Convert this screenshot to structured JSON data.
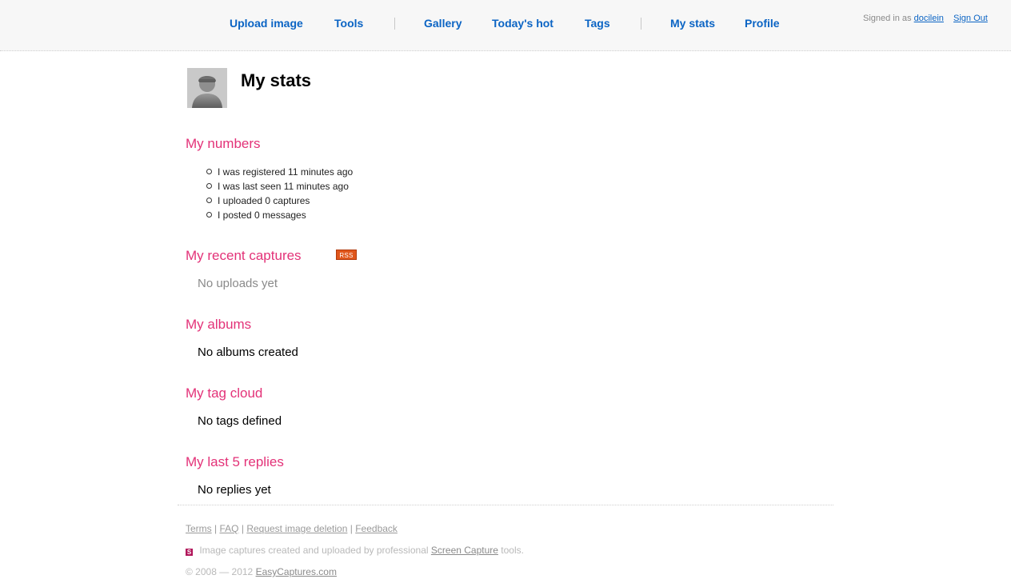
{
  "nav": {
    "upload": "Upload image",
    "tools": "Tools",
    "gallery": "Gallery",
    "todays_hot": "Today's hot",
    "tags": "Tags",
    "my_stats": "My stats",
    "profile": "Profile"
  },
  "session": {
    "signed_in_as": "Signed in as",
    "username": "docilein",
    "sign_out": "Sign Out"
  },
  "page": {
    "title": "My stats"
  },
  "numbers": {
    "title": "My numbers",
    "items": [
      "I was registered 11 minutes ago",
      "I was last seen 11 minutes ago",
      "I uploaded 0 captures",
      "I posted 0 messages"
    ]
  },
  "captures": {
    "title": "My recent captures",
    "rss": "RSS",
    "empty": "No uploads yet"
  },
  "albums": {
    "title": "My albums",
    "empty": "No albums created"
  },
  "tagcloud": {
    "title": "My tag cloud",
    "empty": "No tags defined"
  },
  "replies": {
    "title": "My last 5 replies",
    "empty": "No replies yet"
  },
  "footer": {
    "terms": "Terms",
    "faq": "FAQ",
    "request_deletion": "Request image deletion",
    "feedback": "Feedback",
    "sep": "|",
    "tagline_pre": "Image captures created and uploaded by professional",
    "tagline_link": "Screen Capture",
    "tagline_post": "tools.",
    "logo_letter": "S",
    "copyright": "© 2008 — 2012",
    "site_link": "EasyCaptures.com"
  },
  "colors": {
    "nav_link": "#0b64c4",
    "section_title": "#e33278",
    "header_bg": "#f7f7f7"
  }
}
